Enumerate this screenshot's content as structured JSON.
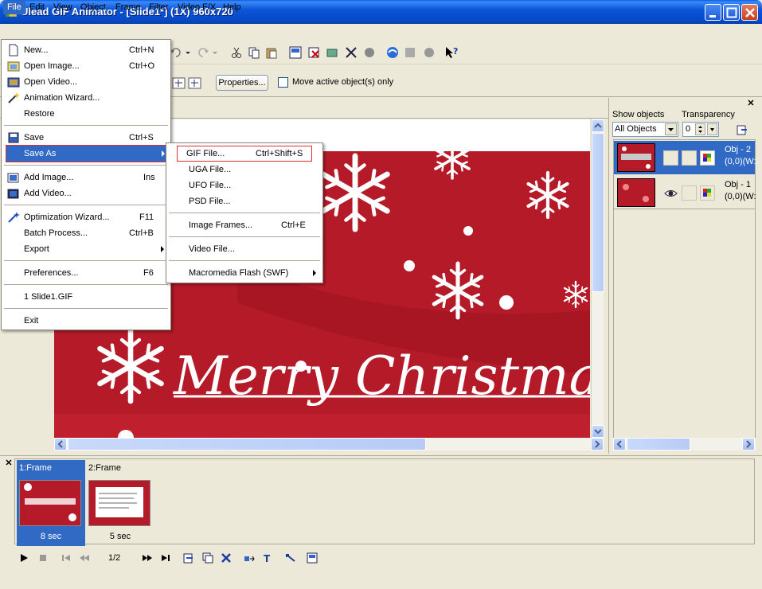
{
  "window": {
    "title": "Ulead GIF Animator - [Slide1*] (1X) 960x720"
  },
  "menubar": {
    "items": [
      "File",
      "Edit",
      "View",
      "Object",
      "Frame",
      "Filter",
      "Video F/X",
      "Help"
    ]
  },
  "file_menu": {
    "new": {
      "label": "New...",
      "shortcut": "Ctrl+N"
    },
    "open_image": {
      "label": "Open Image...",
      "shortcut": "Ctrl+O"
    },
    "open_video": {
      "label": "Open Video..."
    },
    "animation_wizard": {
      "label": "Animation Wizard..."
    },
    "restore": {
      "label": "Restore"
    },
    "save": {
      "label": "Save",
      "shortcut": "Ctrl+S"
    },
    "save_as": {
      "label": "Save As"
    },
    "add_image": {
      "label": "Add Image...",
      "shortcut": "Ins"
    },
    "add_video": {
      "label": "Add Video..."
    },
    "optimization_wizard": {
      "label": "Optimization Wizard...",
      "shortcut": "F11"
    },
    "batch_process": {
      "label": "Batch Process...",
      "shortcut": "Ctrl+B"
    },
    "export": {
      "label": "Export"
    },
    "preferences": {
      "label": "Preferences...",
      "shortcut": "F6"
    },
    "recent_1": {
      "label": "1 Slide1.GIF"
    },
    "exit": {
      "label": "Exit"
    }
  },
  "saveas_menu": {
    "gif_file": {
      "label": "GIF File...",
      "shortcut": "Ctrl+Shift+S"
    },
    "uga_file": {
      "label": "UGA File..."
    },
    "ufo_file": {
      "label": "UFO File..."
    },
    "psd_file": {
      "label": "PSD File..."
    },
    "image_frames": {
      "label": "Image Frames...",
      "shortcut": "Ctrl+E"
    },
    "video_file": {
      "label": "Video File..."
    },
    "macromedia_flash": {
      "label": "Macromedia Flash (SWF)"
    }
  },
  "toolbar2": {
    "properties_label": "Properties...",
    "move_active_label": "Move active object(s) only",
    "move_active_checked": false
  },
  "canvas": {
    "greeting": "Merry Christmas",
    "background_color": "#b51a28"
  },
  "objects_panel": {
    "show_objects_label": "Show objects",
    "show_objects_value": "All Objects",
    "transparency_label": "Transparency",
    "transparency_value": "0",
    "objects": [
      {
        "name": "Obj - 2",
        "pos": "(0,0)(W:",
        "selected": true,
        "visible": false
      },
      {
        "name": "Obj - 1",
        "pos": "(0,0)(W:",
        "selected": false,
        "visible": true
      }
    ]
  },
  "frames_panel": {
    "frames": [
      {
        "label": "1:Frame",
        "delay": "8 sec",
        "selected": true
      },
      {
        "label": "2:Frame",
        "delay": "5 sec",
        "selected": false
      }
    ],
    "counter": "1/2"
  },
  "colors": {
    "accent": "#316ac5",
    "titlebar": "#0b56d8",
    "face": "#ece9d8",
    "highlight_outline": "#e03030"
  }
}
